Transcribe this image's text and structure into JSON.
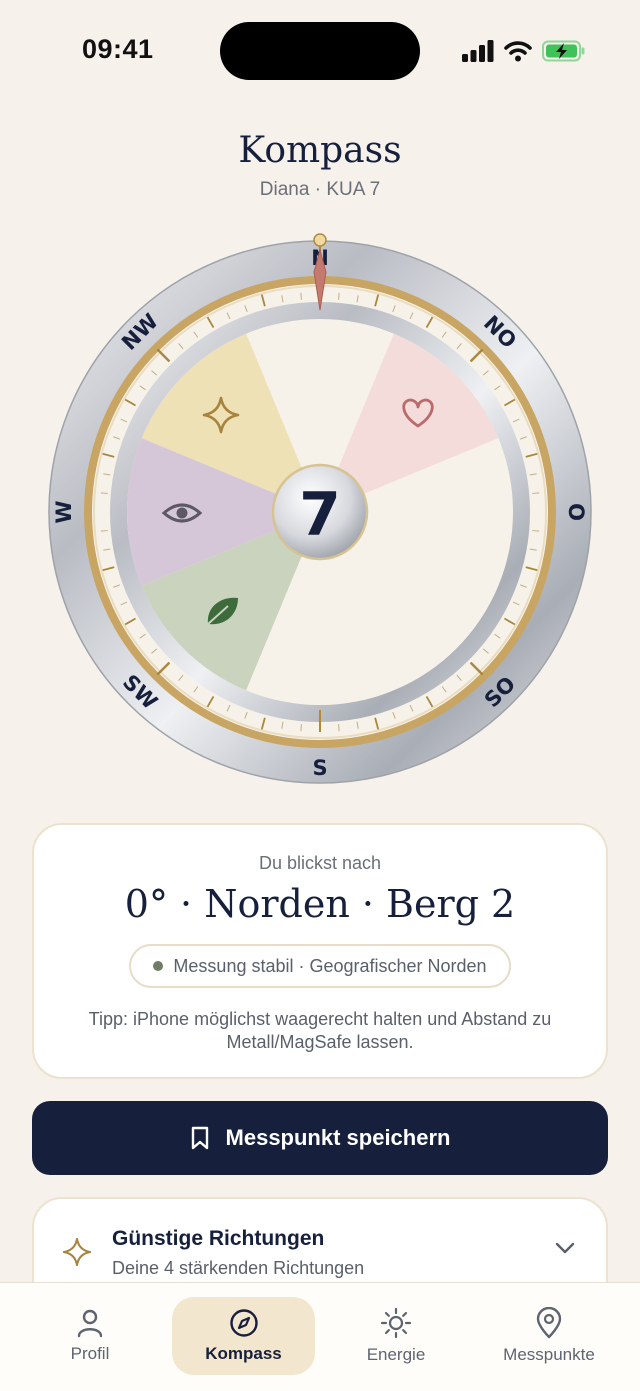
{
  "status_bar": {
    "time": "09:41"
  },
  "header": {
    "title": "Kompass",
    "subtitle": "Diana · KUA 7"
  },
  "compass": {
    "cardinals": {
      "n": "N",
      "no": "NO",
      "o": "O",
      "so": "SO",
      "s": "S",
      "sw": "SW",
      "w": "W",
      "nw": "NW"
    },
    "center_number": "7",
    "heading_degrees": 0,
    "sector_colors": {
      "star": "#efe1b6",
      "eye": "#d6c7d8",
      "leaf": "#c9d3bd",
      "heart": "#f3dcd9"
    }
  },
  "info": {
    "label": "Du blickst nach",
    "heading": "0° · Norden · Berg 2",
    "status": "Messung stabil · Geografischer Norden",
    "tip": "Tipp: iPhone möglichst waagerecht halten und Abstand zu Metall/MagSafe lassen."
  },
  "save_button": {
    "label": "Messpunkt speichern"
  },
  "directions": {
    "title": "Günstige Richtungen",
    "subtitle": "Deine 4 stärkenden Richtungen"
  },
  "tabs": [
    {
      "label": "Profil",
      "icon": "person-icon"
    },
    {
      "label": "Kompass",
      "icon": "compass-icon"
    },
    {
      "label": "Energie",
      "icon": "sun-icon"
    },
    {
      "label": "Messpunkte",
      "icon": "pin-icon"
    }
  ],
  "colors": {
    "navy": "#16203c",
    "gold": "#b08a3c",
    "background": "#f6f1ea"
  }
}
